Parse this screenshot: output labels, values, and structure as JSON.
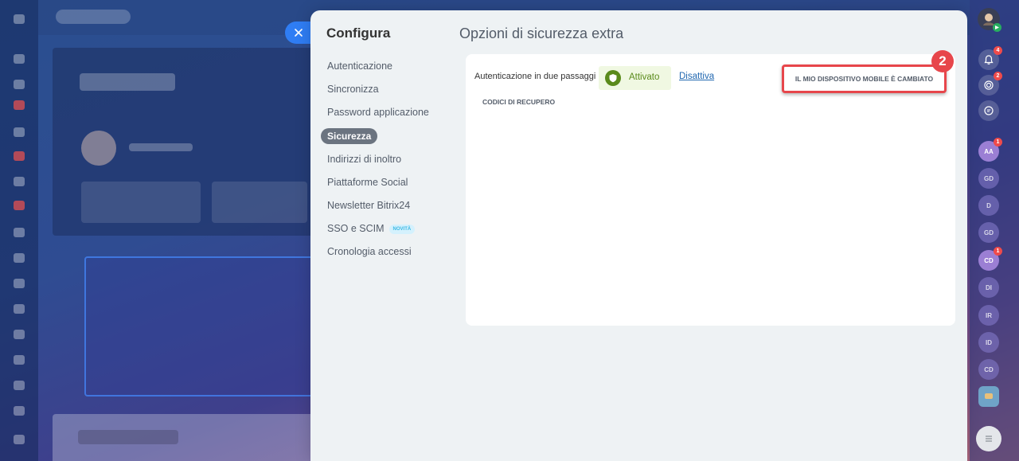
{
  "slider": {
    "nav_title": "Configura",
    "content_title": "Opzioni di sicurezza extra",
    "nav_items": [
      {
        "label": "Autenticazione"
      },
      {
        "label": "Sincronizza"
      },
      {
        "label": "Password applicazione"
      },
      {
        "label": "Sicurezza"
      },
      {
        "label": "Indirizzi di inoltro"
      },
      {
        "label": "Piattaforme Social"
      },
      {
        "label": "Newsletter Bitrix24"
      },
      {
        "label": "SSO e SCIM",
        "badge": "NOVITÀ"
      },
      {
        "label": "Cronologia accessi"
      }
    ],
    "active_nav": "Sicurezza"
  },
  "security": {
    "two_factor_label": "Autenticazione in due passaggi",
    "status_label": "Attivato",
    "disable_link": "Disattiva",
    "device_changed_button": "IL MIO DISPOSITIVO MOBILE È CAMBIATO",
    "recovery_codes_link": "CODICI DI RECUPERO",
    "step_marker": "2"
  },
  "right_rail": {
    "notifications_badge": "4",
    "activity_badge": "2",
    "avatars": [
      {
        "initials": "AA",
        "badge": "1"
      },
      {
        "initials": "GD"
      },
      {
        "initials": "D"
      },
      {
        "initials": "GD"
      },
      {
        "initials": "CD",
        "badge": "1"
      },
      {
        "initials": "DI"
      },
      {
        "initials": "IR"
      },
      {
        "initials": "ID"
      },
      {
        "initials": "CD"
      }
    ]
  },
  "colors": {
    "accent": "#2f7df4",
    "highlight": "#e7464b",
    "success": "#5a8a1b",
    "link": "#2067b0"
  }
}
